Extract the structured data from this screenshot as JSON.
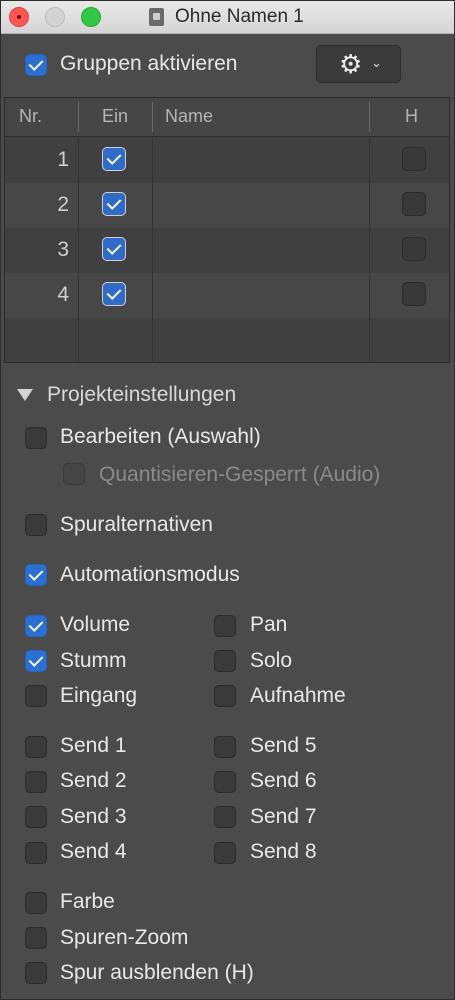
{
  "window": {
    "title": "Ohne Namen 1"
  },
  "groups": {
    "enable_label": "Gruppen aktivieren",
    "enable_checked": true
  },
  "table": {
    "headers": {
      "nr": "Nr.",
      "ein": "Ein",
      "name": "Name",
      "h": "H"
    },
    "rows": [
      {
        "nr": "1",
        "ein": true,
        "name": "",
        "h": false
      },
      {
        "nr": "2",
        "ein": true,
        "name": "",
        "h": false
      },
      {
        "nr": "3",
        "ein": true,
        "name": "",
        "h": false
      },
      {
        "nr": "4",
        "ein": true,
        "name": "",
        "h": false
      }
    ]
  },
  "settings": {
    "section_label": "Projekteinstellungen",
    "bearbeiten": {
      "label": "Bearbeiten (Auswahl)",
      "checked": false
    },
    "quantisieren": {
      "label": "Quantisieren-Gesperrt (Audio)",
      "checked": false,
      "disabled": true
    },
    "spuralternativen": {
      "label": "Spuralternativen",
      "checked": false
    },
    "automationsmodus": {
      "label": "Automationsmodus",
      "checked": true
    },
    "volume": {
      "label": "Volume",
      "checked": true
    },
    "pan": {
      "label": "Pan",
      "checked": false
    },
    "stumm": {
      "label": "Stumm",
      "checked": true
    },
    "solo": {
      "label": "Solo",
      "checked": false
    },
    "eingang": {
      "label": "Eingang",
      "checked": false
    },
    "aufnahme": {
      "label": "Aufnahme",
      "checked": false
    },
    "sends": [
      "Send 1",
      "Send 2",
      "Send 3",
      "Send 4",
      "Send 5",
      "Send 6",
      "Send 7",
      "Send 8"
    ],
    "farbe": {
      "label": "Farbe",
      "checked": false
    },
    "spuren_zoom": {
      "label": "Spuren-Zoom",
      "checked": false
    },
    "spur_ausblenden": {
      "label": "Spur ausblenden (H)",
      "checked": false
    }
  },
  "colors": {
    "accent": "#2b6fd2",
    "background": "#4b4b4b"
  },
  "icons": {
    "gear": "gear-icon",
    "section_toggle": "disclosure-triangle-icon"
  }
}
